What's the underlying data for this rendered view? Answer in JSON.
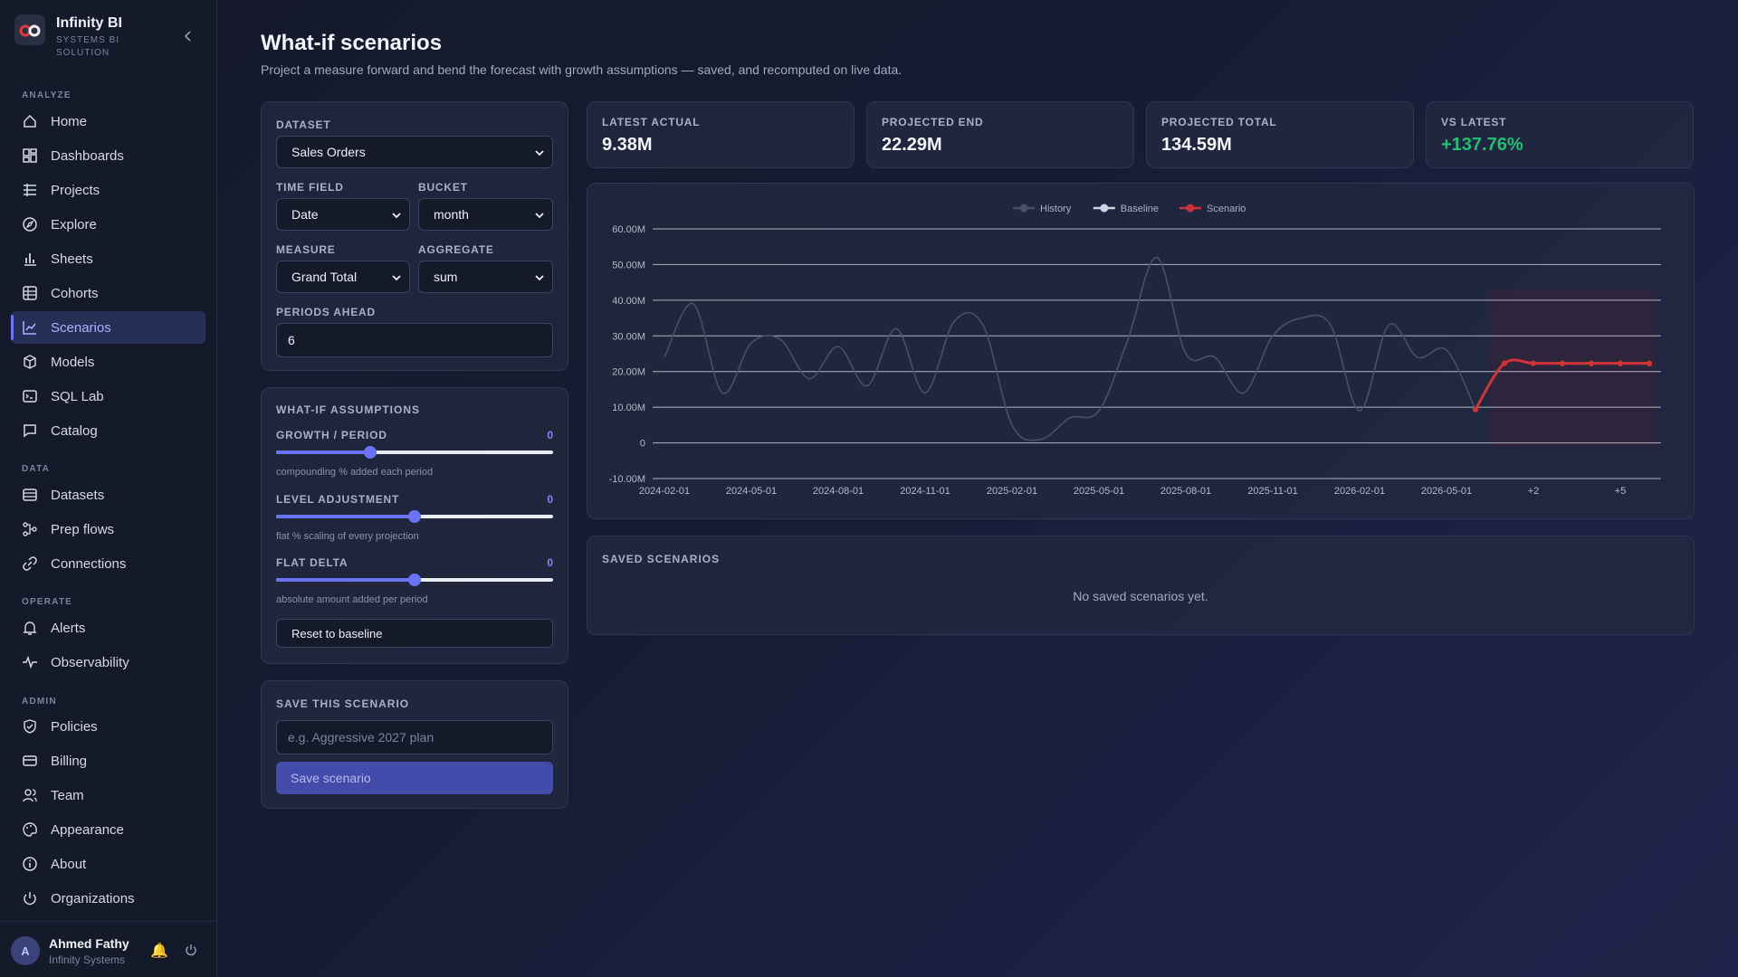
{
  "brand": {
    "name": "Infinity BI",
    "subtitle": "SYSTEMS BI SOLUTION"
  },
  "sidebar": {
    "sections": {
      "analyze": "ANALYZE",
      "data": "DATA",
      "operate": "OPERATE",
      "admin": "ADMIN"
    },
    "items": [
      {
        "label": "Home",
        "icon": "home-icon"
      },
      {
        "label": "Dashboards",
        "icon": "dashboard-icon"
      },
      {
        "label": "Projects",
        "icon": "list-icon"
      },
      {
        "label": "Explore",
        "icon": "compass-icon"
      },
      {
        "label": "Sheets",
        "icon": "bar-chart-icon"
      },
      {
        "label": "Cohorts",
        "icon": "grid-icon"
      },
      {
        "label": "Scenarios",
        "icon": "line-chart-icon",
        "active": true
      },
      {
        "label": "Models",
        "icon": "cube-icon"
      },
      {
        "label": "SQL Lab",
        "icon": "terminal-icon"
      },
      {
        "label": "Catalog",
        "icon": "chat-icon"
      },
      {
        "label": "Datasets",
        "icon": "database-icon"
      },
      {
        "label": "Prep flows",
        "icon": "flow-icon"
      },
      {
        "label": "Connections",
        "icon": "link-icon"
      },
      {
        "label": "Alerts",
        "icon": "bell-icon"
      },
      {
        "label": "Observability",
        "icon": "pulse-icon"
      },
      {
        "label": "Policies",
        "icon": "shield-icon"
      },
      {
        "label": "Billing",
        "icon": "card-icon"
      },
      {
        "label": "Team",
        "icon": "users-icon"
      },
      {
        "label": "Appearance",
        "icon": "palette-icon"
      },
      {
        "label": "About",
        "icon": "info-icon"
      },
      {
        "label": "Organizations",
        "icon": "power-icon"
      }
    ]
  },
  "user": {
    "initial": "A",
    "name": "Ahmed Fathy",
    "org": "Infinity Systems"
  },
  "page": {
    "title": "What-if scenarios",
    "subtitle": "Project a measure forward and bend the forecast with growth assumptions — saved, and recomputed on live data."
  },
  "config": {
    "dataset_label": "DATASET",
    "dataset_value": "Sales Orders",
    "time_field_label": "TIME FIELD",
    "time_field_value": "Date",
    "bucket_label": "BUCKET",
    "bucket_value": "month",
    "measure_label": "MEASURE",
    "measure_value": "Grand Total",
    "aggregate_label": "AGGREGATE",
    "aggregate_value": "sum",
    "periods_label": "PERIODS AHEAD",
    "periods_value": "6"
  },
  "assumptions": {
    "title": "WHAT-IF ASSUMPTIONS",
    "growth": {
      "label": "GROWTH / PERIOD",
      "value": "0",
      "hint": "compounding % added each period",
      "position": 0.34
    },
    "level": {
      "label": "LEVEL ADJUSTMENT",
      "value": "0",
      "hint": "flat % scaling of every projection",
      "position": 0.5
    },
    "flat": {
      "label": "FLAT DELTA",
      "value": "0",
      "hint": "absolute amount added per period",
      "position": 0.5
    },
    "reset_label": "Reset to baseline"
  },
  "save": {
    "title": "SAVE THIS SCENARIO",
    "placeholder": "e.g. Aggressive 2027 plan",
    "button_label": "Save scenario"
  },
  "kpis": [
    {
      "label": "LATEST ACTUAL",
      "value": "9.38M"
    },
    {
      "label": "PROJECTED END",
      "value": "22.29M"
    },
    {
      "label": "PROJECTED TOTAL",
      "value": "134.59M"
    },
    {
      "label": "VS LATEST",
      "value": "+137.76%",
      "color": "#1fbf74"
    }
  ],
  "saved": {
    "title": "SAVED SCENARIOS",
    "empty": "No saved scenarios yet."
  },
  "chart_data": {
    "type": "line",
    "x": [
      "2024-02-01",
      "2024-03-01",
      "2024-04-01",
      "2024-05-01",
      "2024-06-01",
      "2024-07-01",
      "2024-08-01",
      "2024-09-01",
      "2024-10-01",
      "2024-11-01",
      "2024-12-01",
      "2025-01-01",
      "2025-02-01",
      "2025-03-01",
      "2025-04-01",
      "2025-05-01",
      "2025-06-01",
      "2025-07-01",
      "2025-08-01",
      "2025-09-01",
      "2025-10-01",
      "2025-11-01",
      "2025-12-01",
      "2026-01-01",
      "2026-02-01",
      "2026-03-01",
      "2026-04-01",
      "2026-05-01",
      "2026-06-01",
      "+1",
      "+2",
      "+3",
      "+4",
      "+5",
      "+6"
    ],
    "xticks": [
      "2024-02-01",
      "2024-05-01",
      "2024-08-01",
      "2024-11-01",
      "2025-02-01",
      "2025-05-01",
      "2025-08-01",
      "2025-11-01",
      "2026-02-01",
      "2026-05-01",
      "+2",
      "+5"
    ],
    "series": [
      {
        "name": "History",
        "color": "#4a5063",
        "values": [
          24,
          39,
          14,
          28,
          29,
          18,
          27,
          16,
          32,
          14,
          34,
          33,
          5,
          1,
          7,
          9,
          29,
          52,
          25,
          24,
          14,
          30,
          35,
          33,
          9,
          33,
          24,
          26,
          9.38,
          null,
          null,
          null,
          null,
          null,
          null
        ]
      },
      {
        "name": "Baseline",
        "color": "#d0d4df",
        "values": []
      },
      {
        "name": "Scenario",
        "color": "#d0323a",
        "values": [
          null,
          null,
          null,
          null,
          null,
          null,
          null,
          null,
          null,
          null,
          null,
          null,
          null,
          null,
          null,
          null,
          null,
          null,
          null,
          null,
          null,
          null,
          null,
          null,
          null,
          null,
          null,
          null,
          9.38,
          22.3,
          22.3,
          22.29,
          22.29,
          22.29,
          22.29
        ]
      }
    ],
    "yticks": [
      "60.00M",
      "50.00M",
      "40.00M",
      "30.00M",
      "20.00M",
      "10.00M",
      "0",
      "-10.00M"
    ],
    "ylim": [
      -10,
      60
    ],
    "legend": "top-center",
    "grid": true
  }
}
